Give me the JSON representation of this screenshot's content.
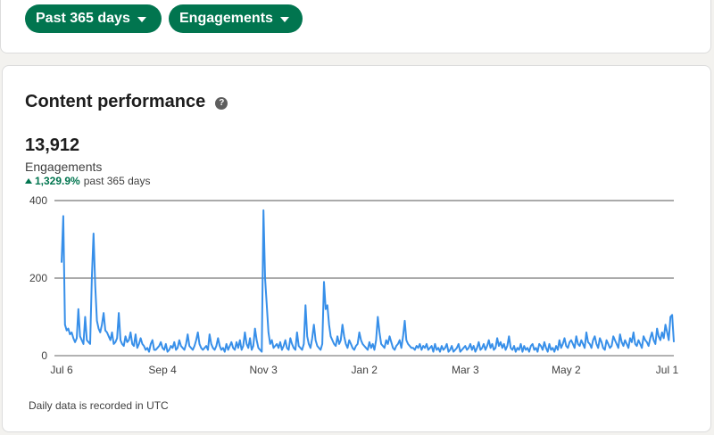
{
  "filters": {
    "range_label": "Past 365 days",
    "metric_label": "Engagements"
  },
  "card": {
    "title": "Content performance",
    "help_icon": "question-circle-icon",
    "total_value": "13,912",
    "metric_name": "Engagements",
    "change_percent": "1,329.9%",
    "change_period": "past 365 days",
    "footnote": "Daily data is recorded in UTC"
  },
  "colors": {
    "accent": "#01754f",
    "line": "#378fe9",
    "grid": "#555555"
  },
  "chart_data": {
    "type": "line",
    "xlabel": "",
    "ylabel": "",
    "ylim": [
      0,
      400
    ],
    "yticks": [
      0,
      200,
      400
    ],
    "grid": true,
    "x_tick_labels": [
      "Jul 6",
      "Sep 4",
      "Nov 3",
      "Jan 2",
      "Mar 3",
      "May 2",
      "Jul 1"
    ],
    "x_tick_days": [
      0,
      60,
      120,
      180,
      240,
      300,
      360
    ],
    "series": [
      {
        "name": "",
        "values": [
          240,
          360,
          80,
          65,
          70,
          55,
          60,
          45,
          35,
          45,
          120,
          50,
          40,
          30,
          100,
          40,
          35,
          30,
          200,
          315,
          180,
          90,
          70,
          60,
          80,
          110,
          65,
          60,
          50,
          40,
          60,
          30,
          35,
          45,
          110,
          40,
          30,
          25,
          50,
          35,
          40,
          60,
          30,
          25,
          55,
          20,
          30,
          45,
          30,
          25,
          15,
          20,
          10,
          30,
          40,
          15,
          15,
          20,
          25,
          35,
          20,
          15,
          30,
          10,
          15,
          25,
          20,
          35,
          15,
          20,
          40,
          25,
          20,
          15,
          30,
          55,
          25,
          20,
          15,
          25,
          40,
          60,
          30,
          20,
          15,
          20,
          25,
          15,
          55,
          30,
          20,
          15,
          25,
          45,
          25,
          15,
          20,
          10,
          30,
          15,
          25,
          35,
          20,
          15,
          35,
          20,
          40,
          15,
          25,
          60,
          30,
          20,
          45,
          15,
          25,
          70,
          40,
          20,
          15,
          10,
          375,
          200,
          130,
          60,
          30,
          40,
          20,
          25,
          30,
          20,
          35,
          15,
          25,
          40,
          20,
          15,
          45,
          30,
          20,
          15,
          60,
          25,
          20,
          15,
          30,
          130,
          50,
          30,
          20,
          45,
          80,
          40,
          25,
          20,
          15,
          30,
          190,
          120,
          130,
          80,
          50,
          40,
          30,
          25,
          50,
          30,
          40,
          80,
          50,
          30,
          20,
          40,
          30,
          20,
          15,
          25,
          30,
          60,
          40,
          30,
          25,
          20,
          15,
          35,
          20,
          30,
          15,
          40,
          100,
          60,
          30,
          25,
          20,
          40,
          30,
          50,
          35,
          20,
          15,
          25,
          30,
          40,
          20,
          50,
          90,
          40,
          30,
          25,
          20,
          20,
          15,
          25,
          20,
          30,
          15,
          25,
          20,
          30,
          15,
          20,
          25,
          10,
          30,
          15,
          20,
          10,
          25,
          15,
          20,
          30,
          10,
          15,
          25,
          10,
          15,
          20,
          30,
          10,
          15,
          20,
          25,
          15,
          20,
          30,
          15,
          25,
          10,
          20,
          35,
          15,
          20,
          30,
          15,
          25,
          40,
          20,
          30,
          15,
          20,
          45,
          25,
          35,
          20,
          30,
          15,
          25,
          50,
          20,
          15,
          25,
          10,
          20,
          15,
          30,
          10,
          25,
          15,
          20,
          10,
          25,
          30,
          15,
          20,
          10,
          30,
          25,
          15,
          35,
          20,
          10,
          30,
          15,
          20,
          10,
          25,
          15,
          40,
          20,
          30,
          45,
          25,
          20,
          35,
          40,
          30,
          20,
          50,
          30,
          25,
          40,
          30,
          20,
          60,
          35,
          30,
          20,
          40,
          50,
          30,
          20,
          45,
          35,
          20,
          15,
          40,
          30,
          20,
          25,
          50,
          40,
          30,
          20,
          55,
          35,
          25,
          40,
          30,
          20,
          45,
          35,
          60,
          30,
          25,
          40,
          30,
          20,
          50,
          40,
          35,
          25,
          45,
          60,
          40,
          30,
          70,
          50,
          40,
          60,
          45,
          80,
          60,
          40,
          100,
          105,
          35
        ]
      }
    ]
  }
}
